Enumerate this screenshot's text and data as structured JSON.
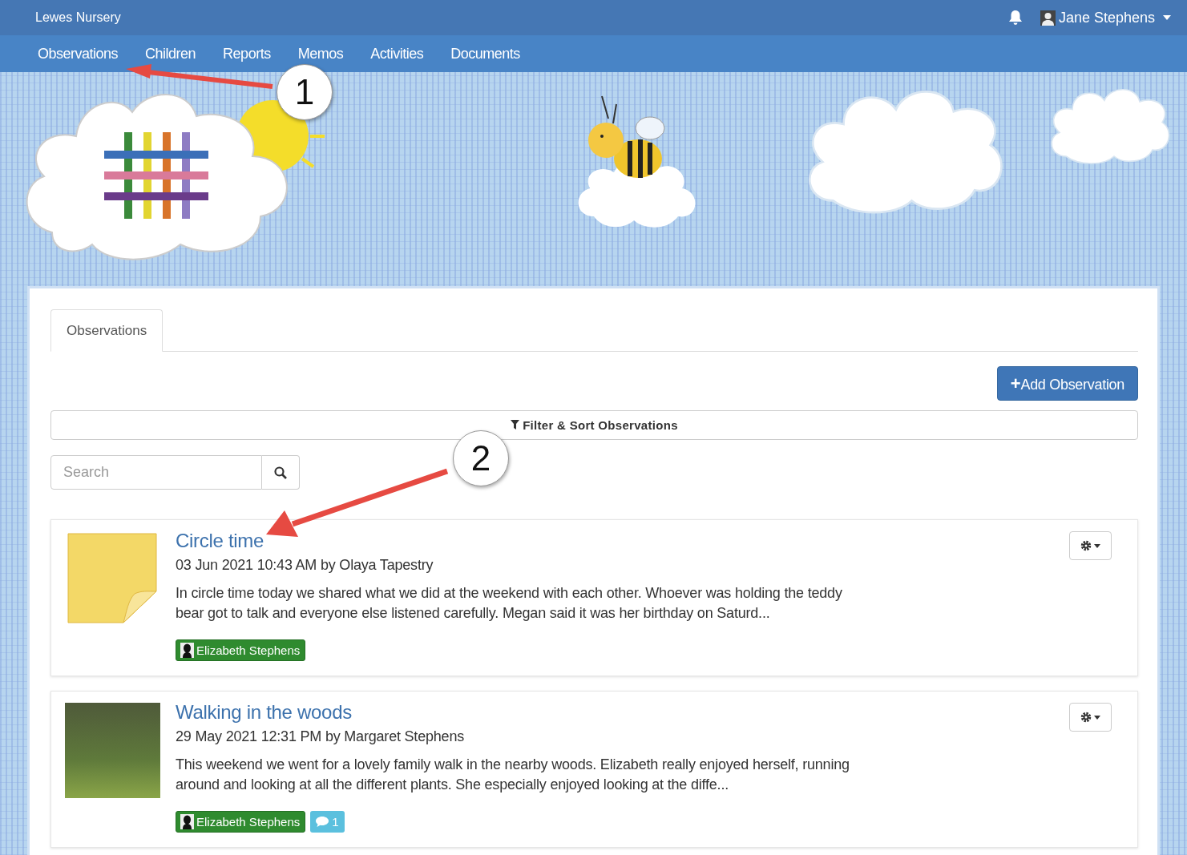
{
  "topbar": {
    "brand": "Lewes Nursery",
    "user": "Jane Stephens"
  },
  "nav": [
    "Observations",
    "Children",
    "Reports",
    "Memos",
    "Activities",
    "Documents"
  ],
  "tabs": [
    {
      "label": "Observations",
      "selected": true
    }
  ],
  "add_button": {
    "icon": "+",
    "label": "Add Observation"
  },
  "filter_bar": {
    "label": "Filter & Sort Observations"
  },
  "search": {
    "placeholder": "Search"
  },
  "observations": [
    {
      "kind": "note",
      "title": "Circle time",
      "meta": "03 Jun 2021 10:43 AM by Olaya Tapestry",
      "text": "In circle time today we shared what we did at the weekend with each other. Whoever was holding the teddy bear got to talk and everyone else listened carefully. Megan said it was her birthday on Saturd...",
      "child": "Elizabeth Stephens"
    },
    {
      "kind": "photo",
      "title": "Walking in the woods",
      "meta": "29 May 2021 12:31 PM by Margaret Stephens",
      "text": "This weekend we went for a lovely family walk in the nearby woods. Elizabeth really enjoyed herself, running around and looking at all the different plants. She especially enjoyed looking at the diffe...",
      "child": "Elizabeth Stephens",
      "comments": "1"
    }
  ],
  "callouts": [
    "1",
    "2"
  ]
}
